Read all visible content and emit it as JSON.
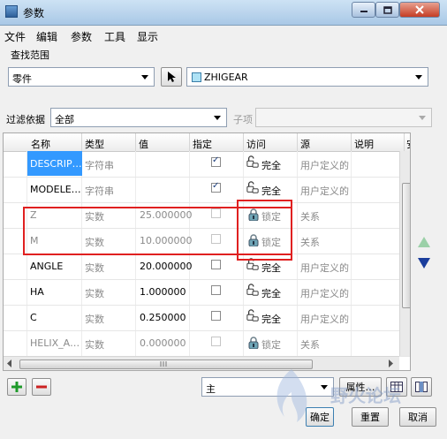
{
  "window": {
    "title": "参数",
    "min_icon": "minimize-icon",
    "max_icon": "maximize-icon",
    "close_icon": "close-icon"
  },
  "menu": [
    "文件",
    "编辑",
    "参数",
    "工具",
    "显示"
  ],
  "search_scope": {
    "group_label": "查找范围",
    "type_value": "零件",
    "object_value": "ZHIGEAR"
  },
  "filter": {
    "label": "过滤依据",
    "value": "全部",
    "subitem_label": "子项"
  },
  "table": {
    "columns": [
      "名称",
      "类型",
      "值",
      "指定",
      "访问",
      "源",
      "说明",
      "安"
    ],
    "rows": [
      {
        "name": "DESCRIP…",
        "type": "字符串",
        "value": "",
        "designated": true,
        "access": "完全",
        "lock": "unlocked",
        "source": "用户定义的",
        "dim": false,
        "selected": true
      },
      {
        "name": "MODELE…",
        "type": "字符串",
        "value": "",
        "designated": true,
        "access": "完全",
        "lock": "unlocked",
        "source": "用户定义的",
        "dim": false,
        "selected": false
      },
      {
        "name": "Z",
        "type": "实数",
        "value": "25.000000",
        "designated": false,
        "access": "锁定",
        "lock": "locked",
        "source": "关系",
        "dim": true,
        "selected": false
      },
      {
        "name": "M",
        "type": "实数",
        "value": "10.000000",
        "designated": false,
        "access": "锁定",
        "lock": "locked",
        "source": "关系",
        "dim": true,
        "selected": false
      },
      {
        "name": "ANGLE",
        "type": "实数",
        "value": "20.000000",
        "designated": false,
        "access": "完全",
        "lock": "unlocked",
        "source": "用户定义的",
        "dim": false,
        "selected": false
      },
      {
        "name": "HA",
        "type": "实数",
        "value": "1.000000",
        "designated": false,
        "access": "完全",
        "lock": "unlocked",
        "source": "用户定义的",
        "dim": false,
        "selected": false
      },
      {
        "name": "C",
        "type": "实数",
        "value": "0.250000",
        "designated": false,
        "access": "完全",
        "lock": "unlocked",
        "source": "用户定义的",
        "dim": false,
        "selected": false
      },
      {
        "name": "HELIX_A…",
        "type": "实数",
        "value": "0.000000",
        "designated": false,
        "access": "锁定",
        "lock": "locked",
        "source": "关系",
        "dim": true,
        "selected": false
      }
    ]
  },
  "bottom": {
    "add_icon": "plus-icon",
    "remove_icon": "minus-icon",
    "main_combo": "主",
    "properties_button": "属性…",
    "ok_button": "确定",
    "reset_button": "重置",
    "cancel_button": "取消"
  },
  "watermark_text": "野火论坛"
}
